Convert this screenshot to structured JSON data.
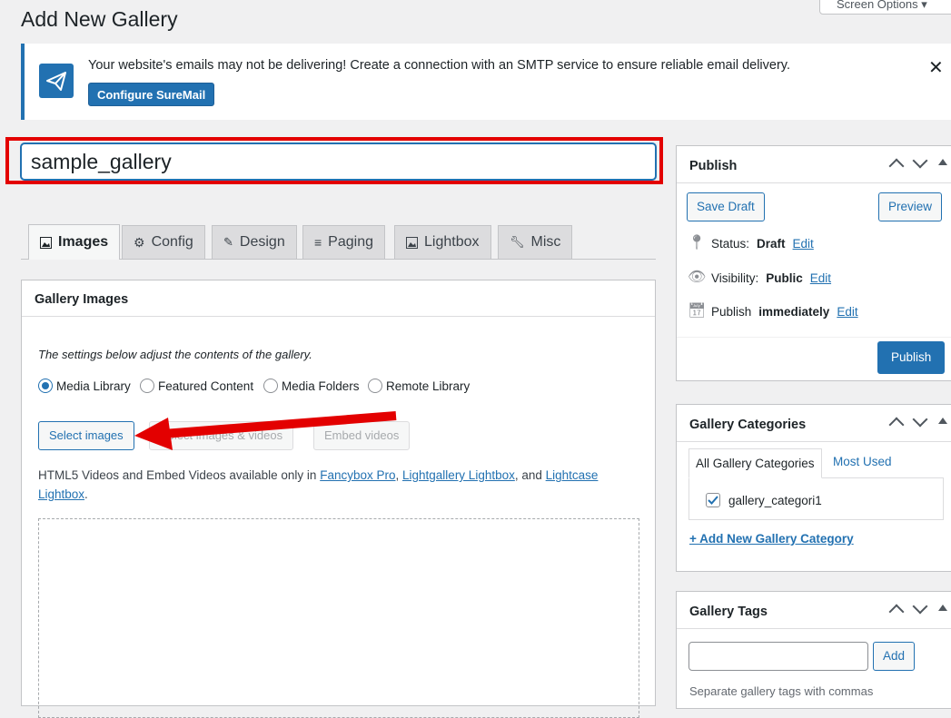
{
  "page": {
    "title": "Add New Gallery",
    "screen_options": "Screen Options ▾"
  },
  "notice": {
    "text": "Your website's emails may not be delivering! Create a connection with an SMTP service to ensure reliable email delivery.",
    "button": "Configure SureMail",
    "close": "✕"
  },
  "post_title": {
    "value": "sample_gallery"
  },
  "tabs": [
    {
      "label": "Images",
      "icon": "image-icon"
    },
    {
      "label": "Config",
      "icon": "gear-icon"
    },
    {
      "label": "Design",
      "icon": "paint-brush-icon"
    },
    {
      "label": "Paging",
      "icon": "list-icon"
    },
    {
      "label": "Lightbox",
      "icon": "image-icon"
    },
    {
      "label": "Misc",
      "icon": "wrench-icon"
    }
  ],
  "gallery_box": {
    "title": "Gallery Images",
    "description": "The settings below adjust the contents of the gallery.",
    "sources": [
      "Media Library",
      "Featured Content",
      "Media Folders",
      "Remote Library"
    ],
    "selected_source": "Media Library",
    "select_images": "Select images",
    "select_images_videos": "Select images & videos",
    "embed_videos": "Embed videos",
    "note_prefix": "HTML5 Videos and Embed Videos available only in ",
    "note_link1": "Fancybox Pro",
    "note_sep1": ", ",
    "note_link2": "Lightgallery Lightbox",
    "note_sep2": ", and ",
    "note_link3": "Lightcase Lightbox",
    "note_suffix": "."
  },
  "publish_box": {
    "title": "Publish",
    "save_draft": "Save Draft",
    "preview": "Preview",
    "status_label": "Status:",
    "status_value": "Draft",
    "visibility_label": "Visibility:",
    "visibility_value": "Public",
    "publish_label": "Publish",
    "publish_value": "immediately",
    "edit": "Edit",
    "publish_button": "Publish"
  },
  "categories_box": {
    "title": "Gallery Categories",
    "tab_all": "All Gallery Categories",
    "tab_most_used": "Most Used",
    "category": "gallery_categori1",
    "add_new": "+ Add New Gallery Category"
  },
  "tags_box": {
    "title": "Gallery Tags",
    "add_button": "Add",
    "hint": "Separate gallery tags with commas"
  },
  "colors": {
    "accent": "#2271b1",
    "highlight": "#e30000"
  }
}
